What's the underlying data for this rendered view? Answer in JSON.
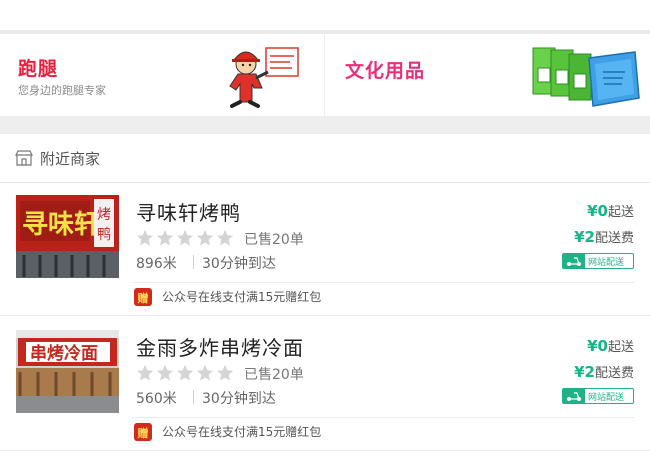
{
  "categories": [
    {
      "title": "跑腿",
      "subtitle": "您身边的跑腿专家",
      "icon": "courier-mascot-icon"
    },
    {
      "title": "文化用品",
      "subtitle": "",
      "icon": "binders-stationery-icon"
    }
  ],
  "nearby": {
    "label": "附近商家",
    "icon": "storefront-icon"
  },
  "shops": [
    {
      "name": "寻味轩烤鸭",
      "rating": 5,
      "sold": "已售20单",
      "distance": "896米",
      "eta": "30分钟到达",
      "min_order_value": "¥0",
      "min_order_label": "起送",
      "delivery_fee_value": "¥2",
      "delivery_fee_label": "配送费",
      "delivery_badge": "网站配送",
      "promo_icon_text": "赠",
      "promo": "公众号在线支付满15元赠红包",
      "thumb_icon": "shop-storefront-photo"
    },
    {
      "name": "金雨多炸串烤冷面",
      "rating": 5,
      "sold": "已售20单",
      "distance": "560米",
      "eta": "30分钟到达",
      "min_order_value": "¥0",
      "min_order_label": "起送",
      "delivery_fee_value": "¥2",
      "delivery_fee_label": "配送费",
      "delivery_badge": "网站配送",
      "promo_icon_text": "赠",
      "promo": "公众号在线支付满15元赠红包",
      "thumb_icon": "shop-storefront-photo"
    }
  ],
  "colors": {
    "accent_red": "#e8203f",
    "accent_pink": "#e8307a",
    "accent_green": "#13b586",
    "star_gray": "#d4d4d4"
  }
}
